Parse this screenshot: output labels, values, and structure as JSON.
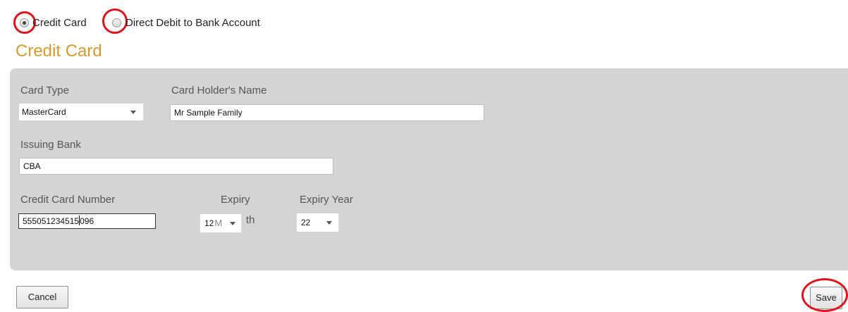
{
  "payment_method": {
    "options": [
      {
        "label": "Credit Card",
        "selected": true
      },
      {
        "label": "Direct Debit to Bank Account",
        "selected": false
      }
    ]
  },
  "section": {
    "title": "Credit Card"
  },
  "form": {
    "card_type": {
      "label": "Card Type",
      "value": "MasterCard"
    },
    "holder_name": {
      "label": "Card Holder's Name",
      "value": "Mr Sample Family"
    },
    "issuing_bank": {
      "label": "Issuing Bank",
      "value": "CBA"
    },
    "card_number": {
      "label": "Credit Card Number",
      "value_before_cursor": "555051234515",
      "value_after_cursor": "096"
    },
    "expiry_month": {
      "label_top": "Expiry",
      "label_hidden_start": "M",
      "label_bottom_tail": "th",
      "value": "12"
    },
    "expiry_year": {
      "label": "Expiry Year",
      "value": "22"
    }
  },
  "actions": {
    "cancel_label": "Cancel",
    "save_label": "Save"
  },
  "colors": {
    "accent": "#d69a2d",
    "panel": "#d4d4d4",
    "highlight_ring": "#e0141a"
  }
}
